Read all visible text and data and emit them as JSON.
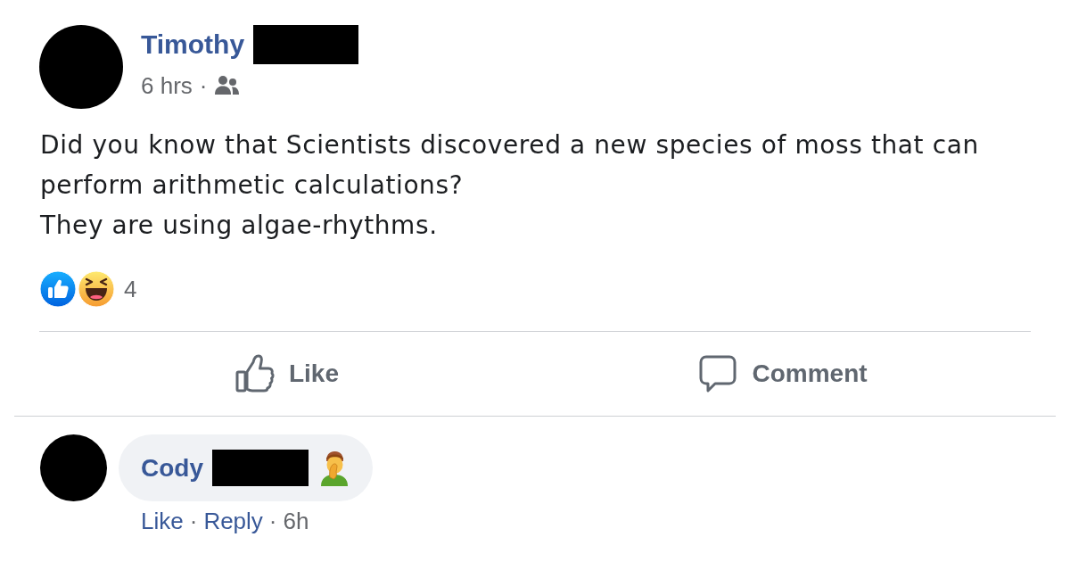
{
  "post": {
    "author": {
      "name": "Timothy",
      "surname_redacted": true
    },
    "time": "6 hrs",
    "separator": "·",
    "paragraphs": [
      "Did you know that Scientists discovered a new species of moss that can perform arithmetic calculations?",
      "They are using algae-rhythms."
    ],
    "reactions": {
      "types": [
        {
          "kind": "like"
        },
        {
          "kind": "haha"
        }
      ],
      "count": "4"
    },
    "actions": [
      {
        "kind": "like",
        "label": "Like"
      },
      {
        "kind": "comment",
        "label": "Comment"
      }
    ]
  },
  "comments": [
    {
      "author": {
        "name": "Cody",
        "surname_redacted": true
      },
      "footer": [
        {
          "kind": "link",
          "text": "Like"
        },
        {
          "kind": "separator",
          "text": "·"
        },
        {
          "kind": "link",
          "text": "Reply"
        },
        {
          "kind": "separator",
          "text": "·"
        },
        {
          "kind": "time",
          "text": "6h"
        }
      ]
    }
  ]
}
